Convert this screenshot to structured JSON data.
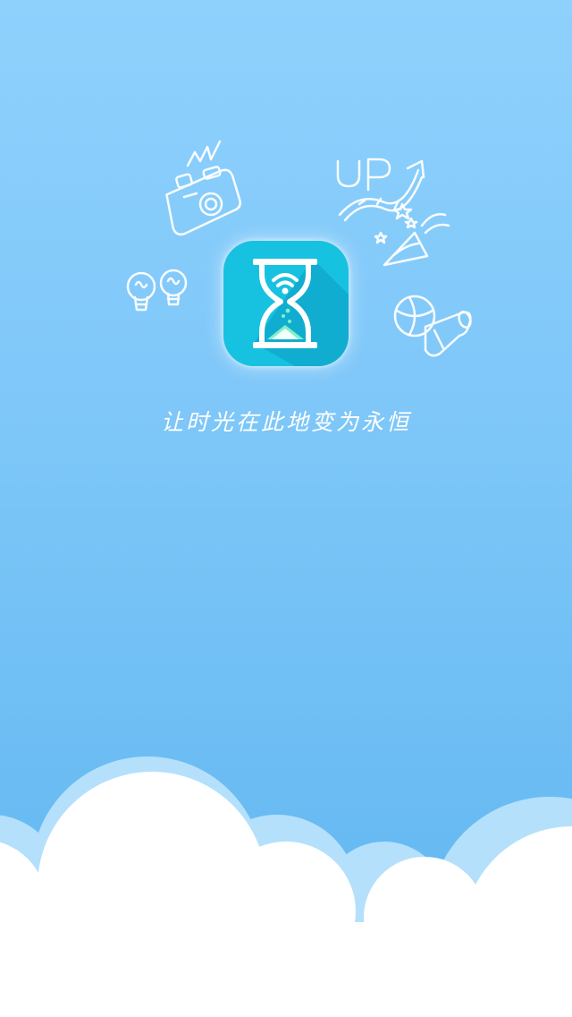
{
  "splash": {
    "tagline": "让时光在此地变为永恒",
    "doodles": [
      "camera-doodle-icon",
      "lightbulb-doodle-icon",
      "up-arrow-doodle-icon",
      "party-horn-doodle-icon",
      "ball-and-scroll-doodle-icon"
    ],
    "app_icon": "hourglass-wifi-icon"
  },
  "colors": {
    "background_top": "#8fd1fd",
    "background_bottom": "#5fb5f0",
    "icon_fill": "#17c2e0",
    "icon_shadow": "#0fa9cd",
    "sand": "#7ff0c8",
    "cloud": "#ffffff",
    "cloud_back": "#b4e0fc"
  }
}
